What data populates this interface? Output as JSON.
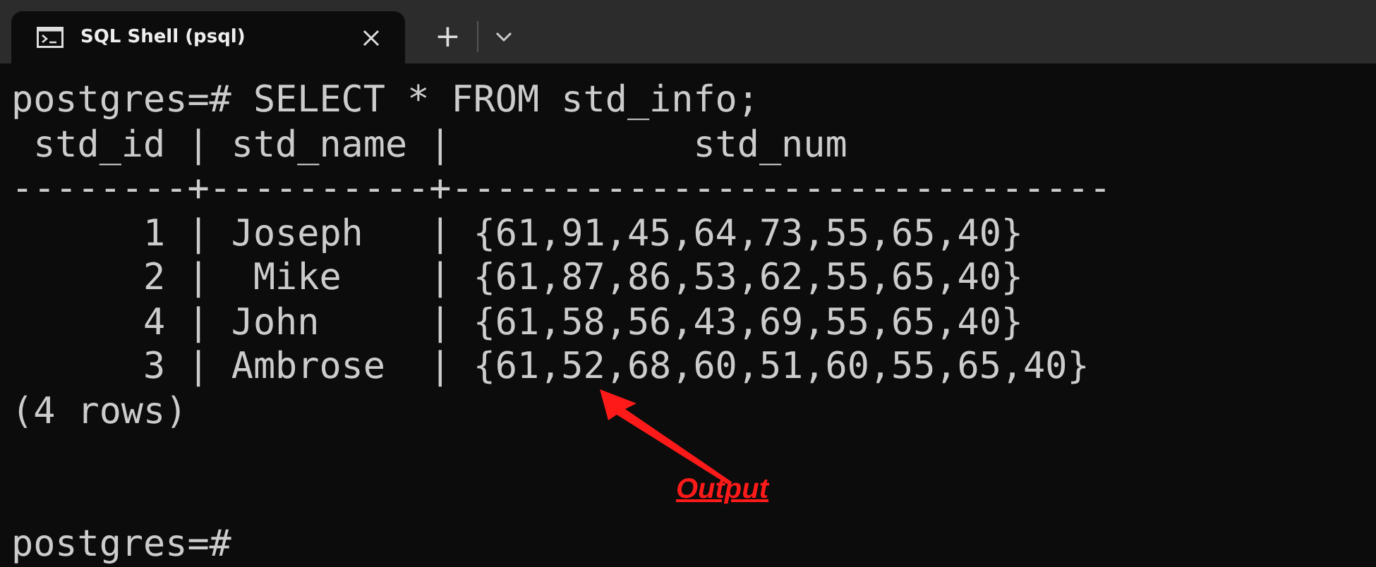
{
  "tabs": [
    {
      "title": "SQL Shell (psql)",
      "selected": true
    }
  ],
  "tab_bar": {
    "new_tab": "+"
  },
  "terminal": {
    "lines": [
      "postgres=# SELECT * FROM std_info;",
      " std_id | std_name |           std_num",
      "--------+----------+------------------------------",
      "      1 | Joseph   | {61,91,45,64,73,55,65,40}",
      "      2 |  Mike    | {61,87,86,53,62,55,65,40}",
      "      4 | John     | {61,58,56,43,69,55,65,40}",
      "      3 | Ambrose  | {61,52,68,60,51,60,55,65,40}",
      "(4 rows)"
    ],
    "prompt": "postgres=#"
  },
  "annotation": {
    "label": "Output"
  }
}
